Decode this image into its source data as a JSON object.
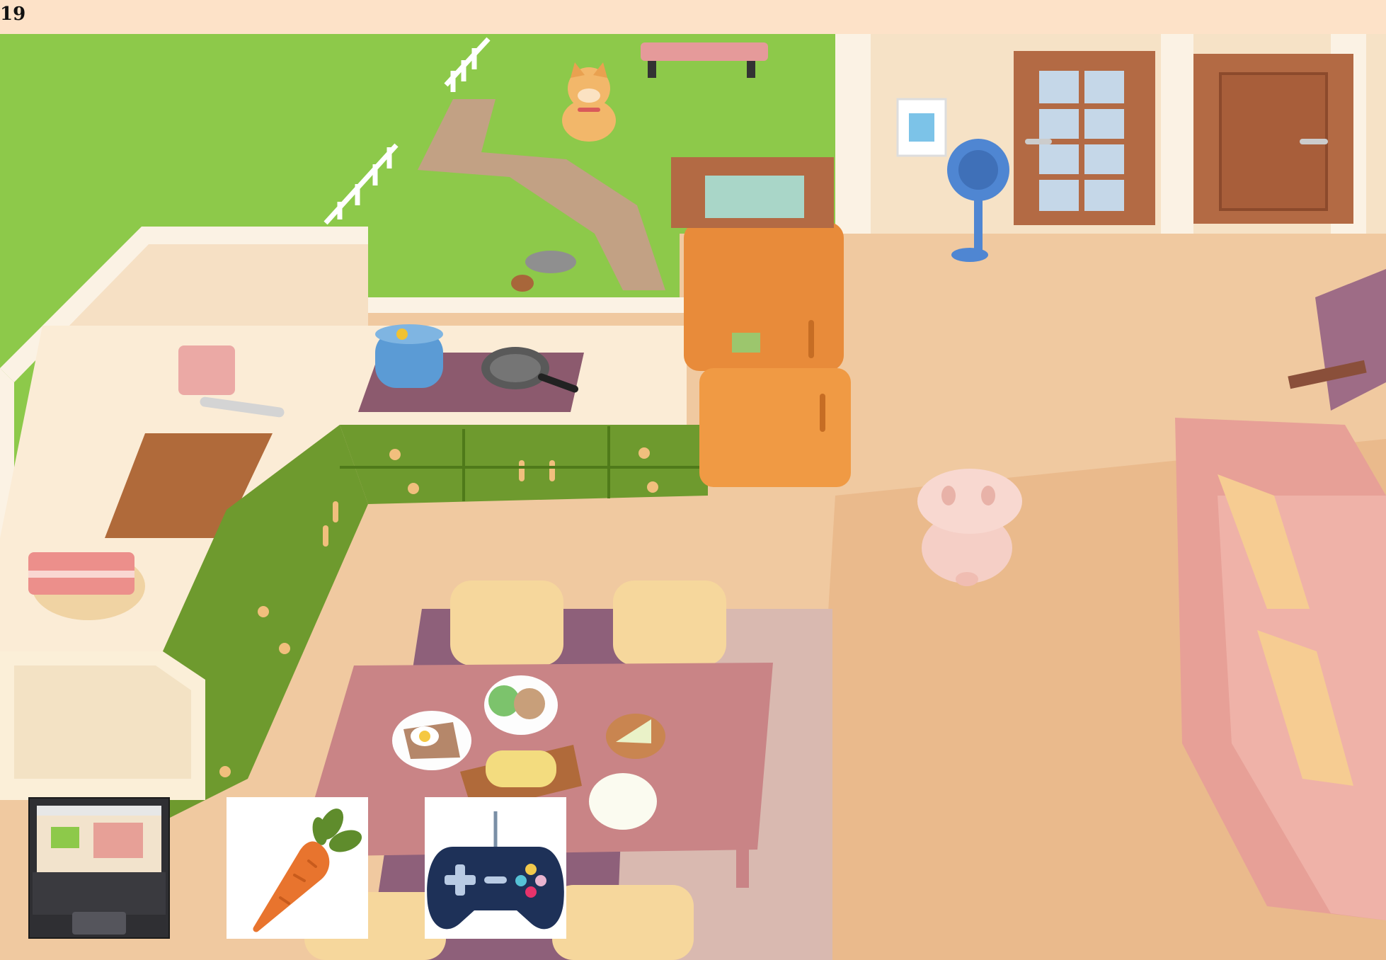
{
  "hud": {
    "counter": "19"
  },
  "inventory": {
    "slots": [
      {
        "icon": "laptop-icon"
      },
      {
        "icon": "carrot-icon"
      },
      {
        "icon": "gamepad-icon"
      }
    ]
  },
  "colors": {
    "grass": "#8dc94a",
    "floor": "#f0c9a0",
    "counter_top": "#fbecd6",
    "cabinet_green": "#6e9a2e",
    "fridge_orange": "#e88b3a",
    "table": "#c98486",
    "sofa_pink": "#e7a097",
    "door_brown": "#b36a44",
    "fan_blue": "#4f86d2",
    "pig_pink": "#f5cfc6"
  }
}
